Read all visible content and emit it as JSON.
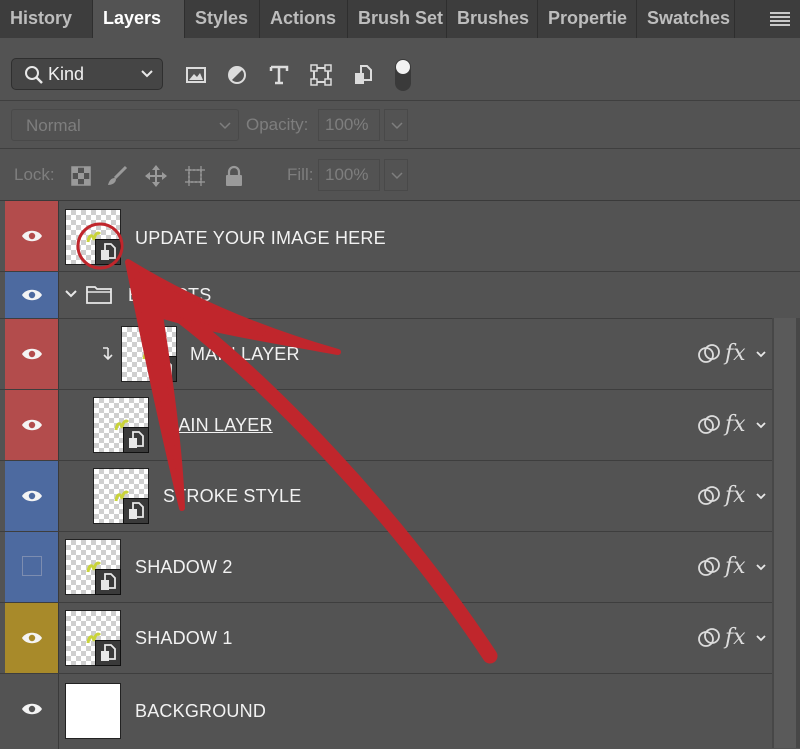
{
  "tabs": [
    {
      "label": "History",
      "active": false
    },
    {
      "label": "Layers",
      "active": true
    },
    {
      "label": "Styles",
      "active": false
    },
    {
      "label": "Actions",
      "active": false
    },
    {
      "label": "Brush Set",
      "active": false
    },
    {
      "label": "Brushes",
      "active": false
    },
    {
      "label": "Propertie",
      "active": false
    },
    {
      "label": "Swatches",
      "active": false
    }
  ],
  "filter": {
    "kind_label": "Kind",
    "icons": [
      "image-filter-icon",
      "adjustment-filter-icon",
      "type-filter-icon",
      "shape-filter-icon",
      "smart-object-filter-icon",
      "filter-toggle-icon"
    ]
  },
  "blend": {
    "mode": "Normal",
    "opacity_label": "Opacity:",
    "opacity_value": "100%"
  },
  "lock": {
    "label": "Lock:",
    "icons": [
      "lock-transparent-pixels-icon",
      "lock-image-pixels-icon",
      "lock-position-icon",
      "lock-artboard-icon",
      "lock-all-icon"
    ],
    "fill_label": "Fill:",
    "fill_value": "100%"
  },
  "layers": [
    {
      "name": "UPDATE YOUR IMAGE HERE",
      "color": "#b34c4c",
      "visible": true,
      "type": "smart",
      "indent": 0,
      "fx": false
    },
    {
      "name": "EFFECTS",
      "color": "#4d6aa0",
      "visible": true,
      "type": "group",
      "indent": 0,
      "fx": false
    },
    {
      "name": "MAIN LAYER",
      "color": "#b34c4c",
      "visible": true,
      "type": "smart",
      "indent": 2,
      "fx": true,
      "clipped": true
    },
    {
      "name": "MAIN LAYER",
      "color": "#b34c4c",
      "visible": true,
      "type": "smart",
      "indent": 1,
      "fx": true,
      "underline": true
    },
    {
      "name": "STROKE STYLE",
      "color": "#4d6aa0",
      "visible": true,
      "type": "smart",
      "indent": 1,
      "fx": true
    },
    {
      "name": "SHADOW 2",
      "color": "#4d6aa0",
      "visible": false,
      "type": "smart",
      "indent": 0,
      "fx": true
    },
    {
      "name": "SHADOW 1",
      "color": "#a88a2a",
      "visible": true,
      "type": "smart",
      "indent": 0,
      "fx": true
    },
    {
      "name": "BACKGROUND",
      "color": "#535353",
      "visible": true,
      "type": "background",
      "indent": 0,
      "fx": false
    }
  ],
  "fx_label": "fx",
  "colors": {
    "panel_bg": "#535353",
    "tabbar_bg": "#3d3d3d",
    "annotation_red": "#c0262c"
  }
}
